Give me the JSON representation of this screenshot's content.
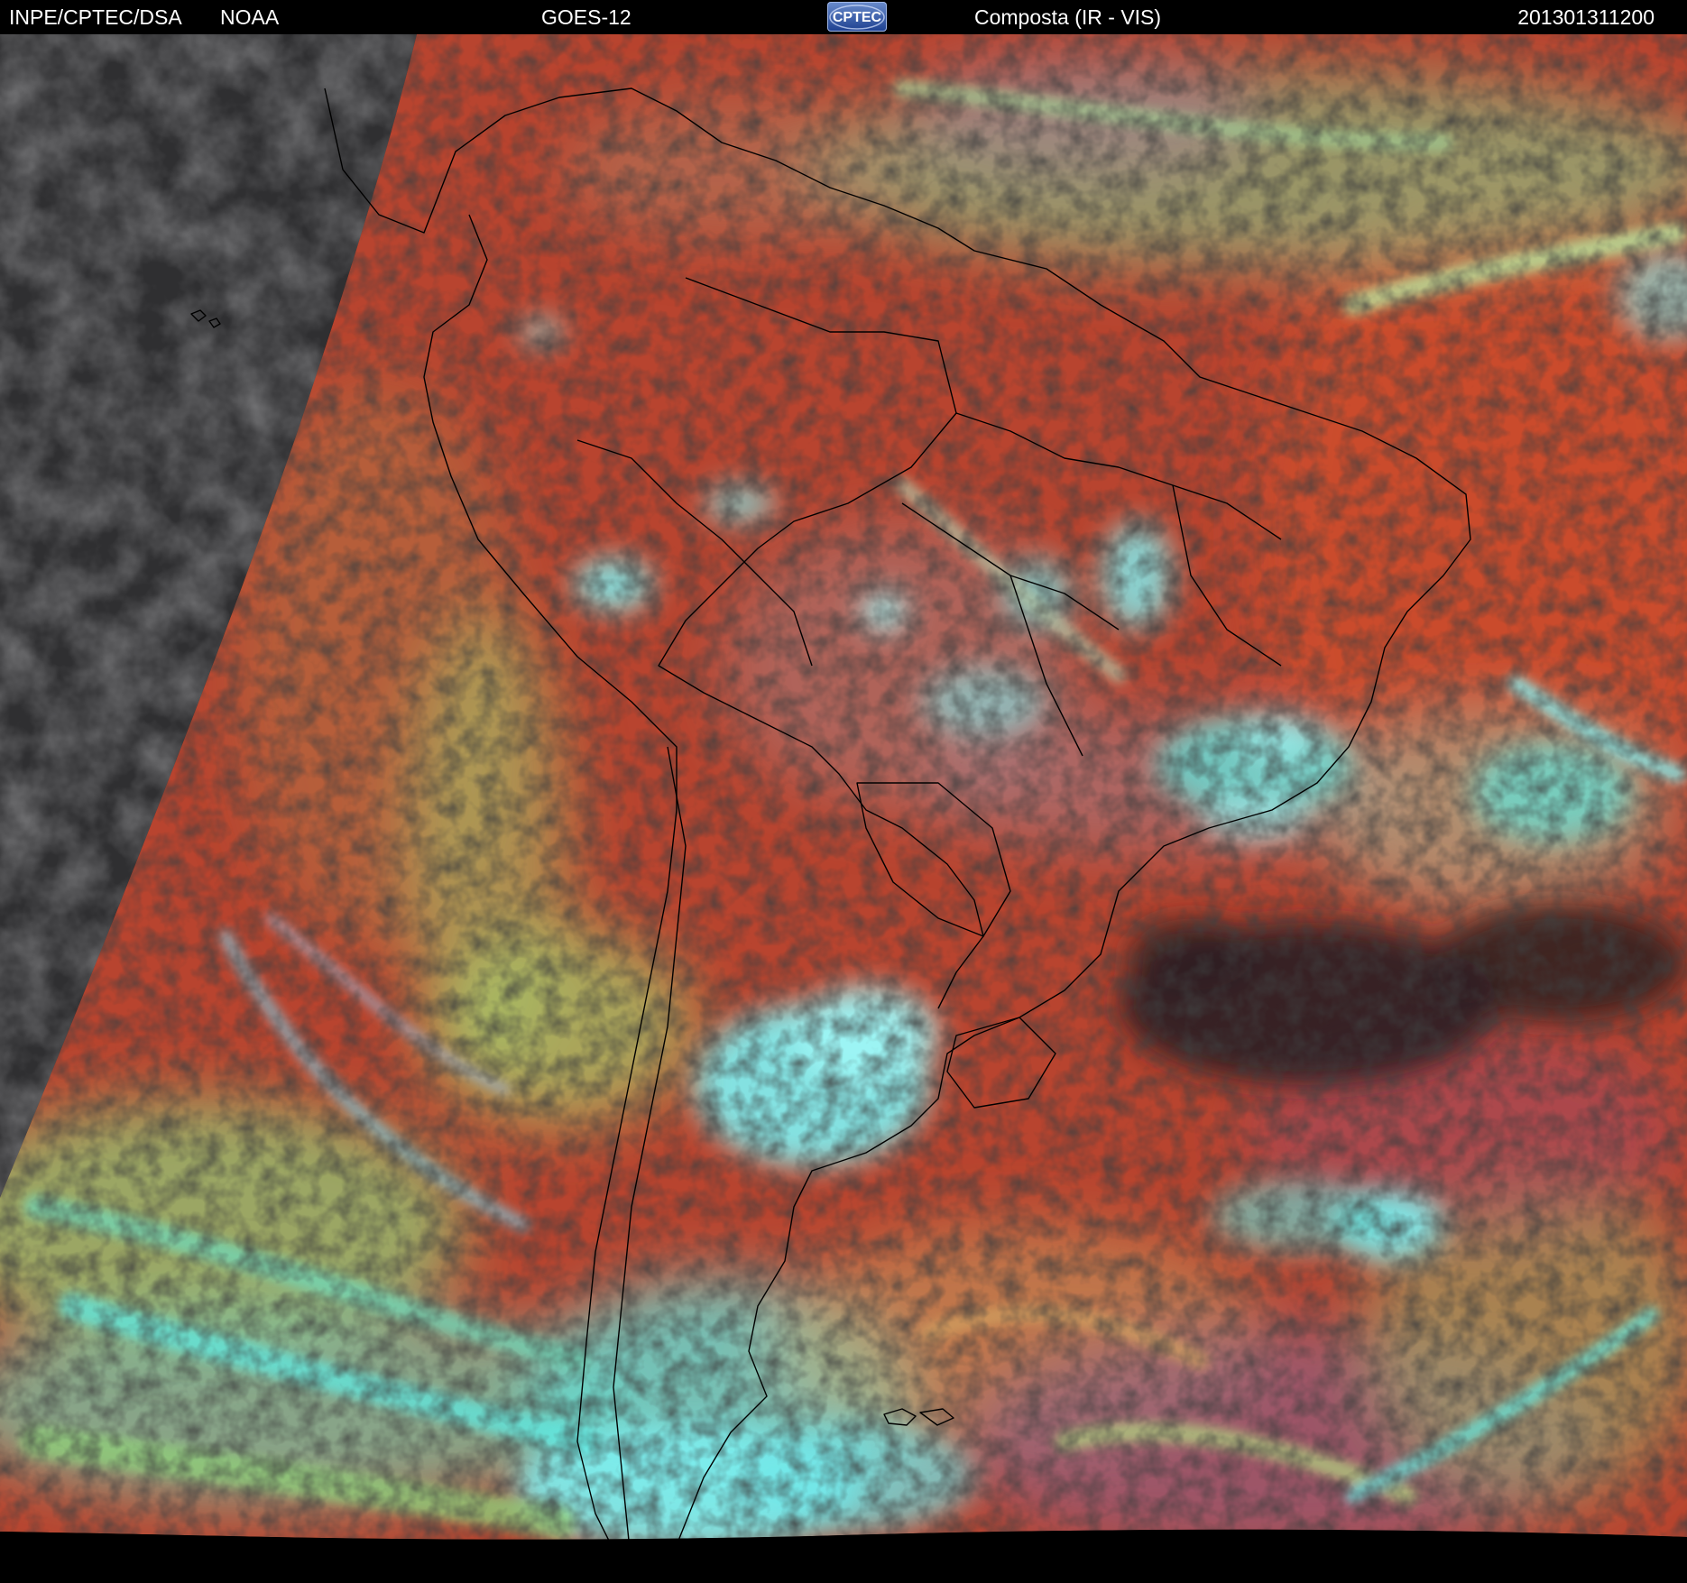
{
  "header": {
    "source": "INPE/CPTEC/DSA",
    "agency": "NOAA",
    "satellite": "GOES-12",
    "logo_text": "CPTEC",
    "product": "Composta (IR - VIS)",
    "timestamp": "201301311200"
  },
  "palette": {
    "space": "#000000",
    "night_side": "#2f2f31",
    "clear_sky": "#b8442f",
    "clear_sky_warm": "#cc4e2c",
    "low_cloud": "#9f8a5a",
    "mid_cloud": "#a6c66a",
    "high_cloud": "#5fe8e0",
    "dense_high_cloud": "#7ef3f5",
    "cold_sea_clear": "#2a1f22",
    "mauve_cloud": "#8a5f8e",
    "coastline": "#000000"
  }
}
